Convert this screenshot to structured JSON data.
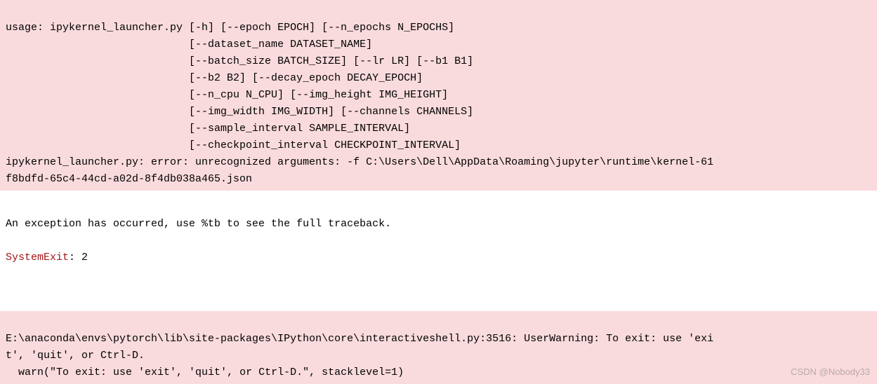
{
  "error": {
    "line1": "usage: ipykernel_launcher.py [-h] [--epoch EPOCH] [--n_epochs N_EPOCHS]",
    "line2": "                             [--dataset_name DATASET_NAME]",
    "line3": "                             [--batch_size BATCH_SIZE] [--lr LR] [--b1 B1]",
    "line4": "                             [--b2 B2] [--decay_epoch DECAY_EPOCH]",
    "line5": "                             [--n_cpu N_CPU] [--img_height IMG_HEIGHT]",
    "line6": "                             [--img_width IMG_WIDTH] [--channels CHANNELS]",
    "line7": "                             [--sample_interval SAMPLE_INTERVAL]",
    "line8": "                             [--checkpoint_interval CHECKPOINT_INTERVAL]",
    "line9": "ipykernel_launcher.py: error: unrecognized arguments: -f C:\\Users\\Dell\\AppData\\Roaming\\jupyter\\runtime\\kernel-61",
    "line10": "f8bdfd-65c4-44cd-a02d-8f4db038a465.json"
  },
  "exception": {
    "message": "An exception has occurred, use %tb to see the full traceback.",
    "systemexit_label": "SystemExit",
    "systemexit_value": ": 2"
  },
  "warning": {
    "line1": "E:\\anaconda\\envs\\pytorch\\lib\\site-packages\\IPython\\core\\interactiveshell.py:3516: UserWarning: To exit: use 'exi",
    "line2": "t', 'quit', or Ctrl-D.",
    "line3": "  warn(\"To exit: use 'exit', 'quit', or Ctrl-D.\", stacklevel=1)"
  },
  "watermark": "CSDN @Nobody33"
}
